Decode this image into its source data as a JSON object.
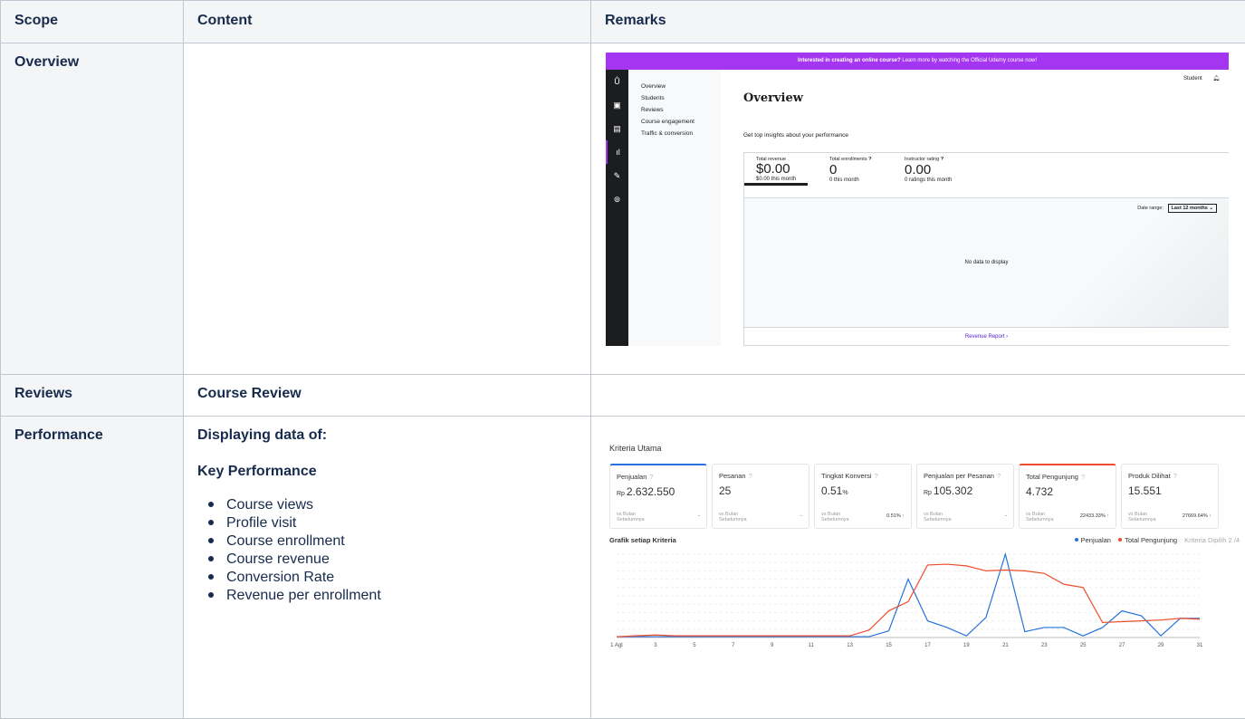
{
  "table": {
    "headers": {
      "scope": "Scope",
      "content": "Content",
      "remarks": "Remarks"
    },
    "rows": {
      "overview": {
        "scope": "Overview",
        "content": ""
      },
      "reviews": {
        "scope": "Reviews",
        "content": "Course Review"
      },
      "performance": {
        "scope": "Performance",
        "heading": "Displaying data of:",
        "subheading": "Key Performance",
        "items": [
          "Course views",
          "Profile visit",
          "Course enrollment",
          "Course revenue",
          "Conversion Rate",
          "Revenue per enrollment"
        ]
      }
    }
  },
  "udemy": {
    "banner_bold": "Interested in creating an online course?",
    "banner_rest": "Learn more by watching the Official Udemy course now!",
    "rail_icons": [
      "udemy-logo-icon",
      "video-icon",
      "chat-icon",
      "bar-chart-icon",
      "wrench-icon",
      "help-icon"
    ],
    "nav": [
      "Overview",
      "Students",
      "Reviews",
      "Course engagement",
      "Traffic & conversion"
    ],
    "user": "Student",
    "title": "Overview",
    "subtitle": "Get top insights about your performance",
    "stats": [
      {
        "label": "Total revenue",
        "value": "$0.00",
        "sub": "$0.00 this month"
      },
      {
        "label": "Total enrollments",
        "value": "0",
        "sub": "0 this month"
      },
      {
        "label": "Instructor rating",
        "value": "0.00",
        "sub": "0 ratings this month"
      }
    ],
    "date_range_label": "Date range:",
    "date_range_value": "Last 12 months",
    "no_data": "No data to display",
    "footer_link": "Revenue Report ›",
    "accent": "#a435f0"
  },
  "performance_mock": {
    "heading": "Kriteria Utama",
    "cards": [
      {
        "name": "Penjualan",
        "prefix": "Rp",
        "value": "2.632.550",
        "compare": "vs Bulan Sebelumnya",
        "delta": "-"
      },
      {
        "name": "Pesanan",
        "prefix": "",
        "value": "25",
        "compare": "vs Bulan Sebelumnya",
        "delta": "-"
      },
      {
        "name": "Tingkat Konversi",
        "prefix": "",
        "value": "0.51",
        "suffix": "%",
        "compare": "vs Bulan Sebelumnya",
        "delta": "0.51%"
      },
      {
        "name": "Penjualan per Pesanan",
        "prefix": "Rp",
        "value": "105.302",
        "compare": "vs Bulan Sebelumnya",
        "delta": "-"
      },
      {
        "name": "Total Pengunjung",
        "prefix": "",
        "value": "4.732",
        "compare": "vs Bulan Sebelumnya",
        "delta": "22433.33%"
      },
      {
        "name": "Produk Dilihat",
        "prefix": "",
        "value": "15.551",
        "compare": "vs Bulan Sebelumnya",
        "delta": "27669.64%"
      }
    ],
    "chart_title": "Grafik setiap Kriteria",
    "legend": [
      "Penjualan",
      "Total Pengunjung"
    ],
    "criteria_note": "Kriteria Dipilih 2 /4",
    "colors": {
      "penjualan": "#2673dd",
      "pengunjung": "#ee4d2d"
    }
  },
  "chart_data": {
    "type": "line",
    "title": "Grafik setiap Kriteria",
    "x": [
      1,
      2,
      3,
      4,
      5,
      6,
      7,
      8,
      9,
      10,
      11,
      12,
      13,
      14,
      15,
      16,
      17,
      18,
      19,
      20,
      21,
      22,
      23,
      24,
      25,
      26,
      27,
      28,
      29,
      30,
      31
    ],
    "xticks": [
      "1 Agt",
      "3",
      "5",
      "7",
      "9",
      "11",
      "13",
      "15",
      "17",
      "19",
      "21",
      "23",
      "25",
      "27",
      "29",
      "31"
    ],
    "ylim": [
      0,
      100
    ],
    "series": [
      {
        "name": "Penjualan",
        "values": [
          1,
          1,
          1,
          1,
          1,
          1,
          1,
          1,
          1,
          1,
          1,
          1,
          1,
          1,
          8,
          70,
          20,
          12,
          2,
          24,
          100,
          7,
          12,
          12,
          2,
          12,
          32,
          26,
          2,
          23,
          23
        ]
      },
      {
        "name": "Total Pengunjung",
        "values": [
          1,
          2,
          3,
          2,
          2,
          2,
          2,
          2,
          2,
          2,
          2,
          2,
          2,
          9,
          32,
          43,
          87,
          88,
          86,
          80,
          81,
          80,
          77,
          64,
          60,
          18,
          19,
          20,
          21,
          23,
          22
        ]
      }
    ]
  }
}
